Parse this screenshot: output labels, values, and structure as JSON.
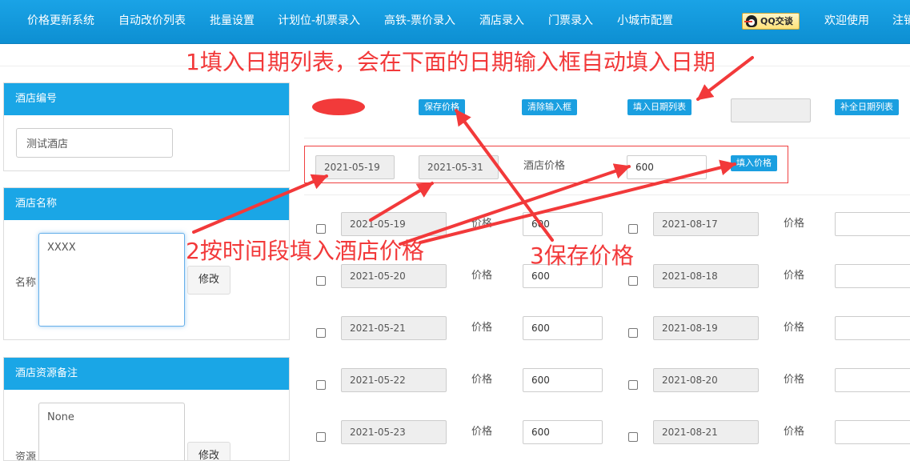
{
  "nav": {
    "items": [
      "价格更新系统",
      "自动改价列表",
      "批量设置",
      "计划位-机票录入",
      "高铁-票价录入",
      "酒店录入",
      "门票录入",
      "小城市配置"
    ],
    "qq_label": "QQ交谈",
    "welcome": "欢迎使用",
    "logout_partial": "注销"
  },
  "colors": {
    "nav_bg": "#1aa3e6",
    "panel_heading": "#1aa6e6",
    "button": "#1a9fe0",
    "annotation": "#f2393a"
  },
  "left": {
    "hotel_code": {
      "heading": "酒店编号",
      "value": "测试酒店"
    },
    "hotel_name": {
      "heading": "酒店名称",
      "label": "名称",
      "value": "XXXX",
      "modify": "修改"
    },
    "hotel_note": {
      "heading": "酒店资源备注",
      "label": "资源",
      "value": "None",
      "modify": "修改"
    }
  },
  "toolbar": {
    "save": "保存价格",
    "clear": "清除输入框",
    "fill_dates": "填入日期列表",
    "date_list_value": "",
    "complete_dates": "补全日期列表"
  },
  "range": {
    "start": "2021-05-19",
    "end": "2021-05-31",
    "price_label": "酒店价格",
    "price": "600",
    "fill_price": "填入价格"
  },
  "price_label": "价格",
  "rows_left": [
    {
      "date": "2021-05-19",
      "price": "600"
    },
    {
      "date": "2021-05-20",
      "price": "600"
    },
    {
      "date": "2021-05-21",
      "price": "600"
    },
    {
      "date": "2021-05-22",
      "price": "600"
    },
    {
      "date": "2021-05-23",
      "price": "600"
    }
  ],
  "rows_right": [
    {
      "date": "2021-08-17",
      "price": ""
    },
    {
      "date": "2021-08-18",
      "price": ""
    },
    {
      "date": "2021-08-19",
      "price": ""
    },
    {
      "date": "2021-08-20",
      "price": ""
    },
    {
      "date": "2021-08-21",
      "price": ""
    }
  ],
  "annotations": {
    "a1": "1填入日期列表，会在下面的日期输入框自动填入日期",
    "a2": "2按时间段填入酒店价格",
    "a3": "3保存价格"
  }
}
